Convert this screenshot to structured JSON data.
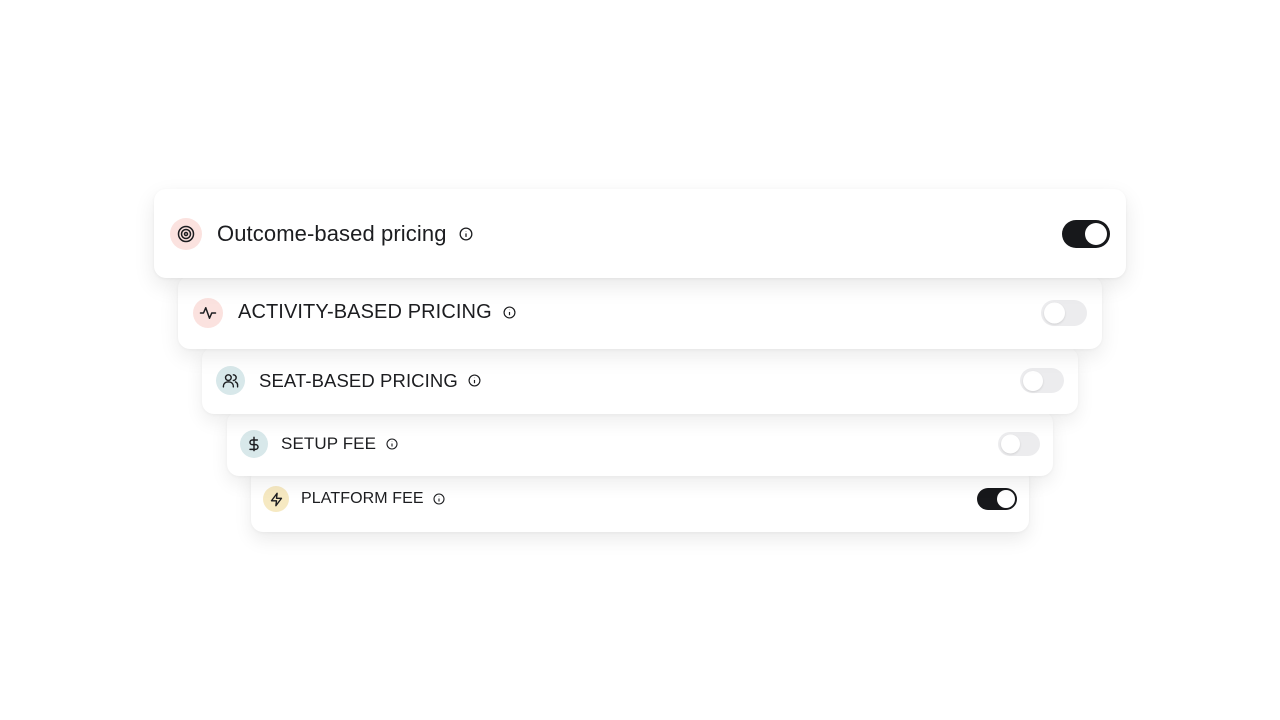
{
  "colors": {
    "toggle_on": "#17181b",
    "toggle_off": "#ececee",
    "card_background": "#ffffff",
    "text": "#1c1d20"
  },
  "pricing_options": [
    {
      "label": "Outcome-based pricing",
      "icon": "target-icon",
      "icon_bg": "#fbe2df",
      "enabled": true
    },
    {
      "label": "ACTIVITY-BASED PRICING",
      "icon": "activity-icon",
      "icon_bg": "#fbe2df",
      "enabled": false
    },
    {
      "label": "SEAT-BASED PRICING",
      "icon": "users-icon",
      "icon_bg": "#d8e8ea",
      "enabled": false
    },
    {
      "label": "SETUP FEE",
      "icon": "dollar-icon",
      "icon_bg": "#d8e8ea",
      "enabled": false
    },
    {
      "label": "PLATFORM FEE",
      "icon": "lightning-icon",
      "icon_bg": "#f6e9c2",
      "enabled": true
    }
  ]
}
